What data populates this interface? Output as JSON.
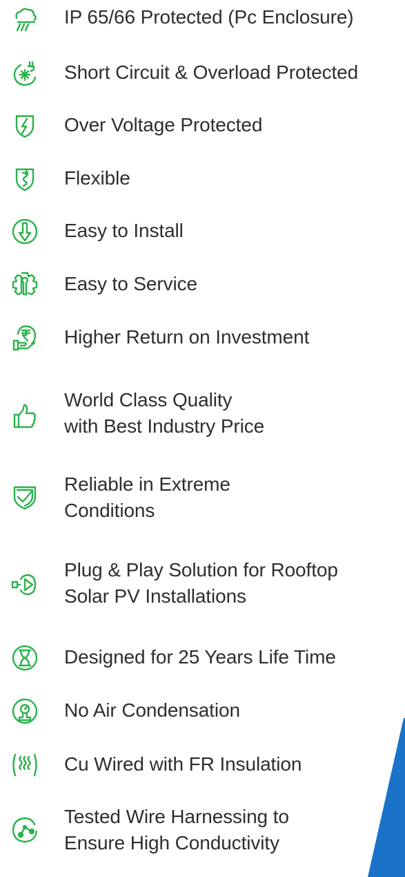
{
  "colors": {
    "accent": "#2bb24c",
    "text": "#2e2e2e",
    "blue": "#1a73c8"
  },
  "features": [
    {
      "icon": "rain-cloud-icon",
      "lines": [
        "IP 65/66 Protected (Pc Enclosure)"
      ]
    },
    {
      "icon": "short-circuit-icon",
      "lines": [
        "Short Circuit & Overload Protected"
      ]
    },
    {
      "icon": "lightning-shield-icon",
      "lines": [
        "Over Voltage Protected"
      ]
    },
    {
      "icon": "flexible-shield-icon",
      "lines": [
        "Flexible"
      ]
    },
    {
      "icon": "install-arrow-icon",
      "lines": [
        "Easy to Install"
      ]
    },
    {
      "icon": "service-gear-icon",
      "lines": [
        "Easy to Service"
      ]
    },
    {
      "icon": "rupee-hand-icon",
      "lines": [
        "Higher Return on Investment"
      ]
    },
    {
      "icon": "thumbs-up-icon",
      "lines": [
        "World  Class Quality",
        "with Best Industry Price"
      ]
    },
    {
      "icon": "check-shield-icon",
      "lines": [
        "Reliable in Extreme",
        "Conditions"
      ]
    },
    {
      "icon": "plug-play-icon",
      "lines": [
        "Plug & Play Solution for Rooftop",
        "Solar PV Installations"
      ]
    },
    {
      "icon": "hourglass-icon",
      "lines": [
        "Designed for 25 Years Life Time"
      ]
    },
    {
      "icon": "pressure-gauge-icon",
      "lines": [
        "No Air Condensation"
      ]
    },
    {
      "icon": "heat-waves-icon",
      "lines": [
        "Cu Wired with FR Insulation"
      ]
    },
    {
      "icon": "conductivity-icon",
      "lines": [
        "Tested Wire Harnessing to",
        "Ensure High Conductivity"
      ]
    }
  ]
}
